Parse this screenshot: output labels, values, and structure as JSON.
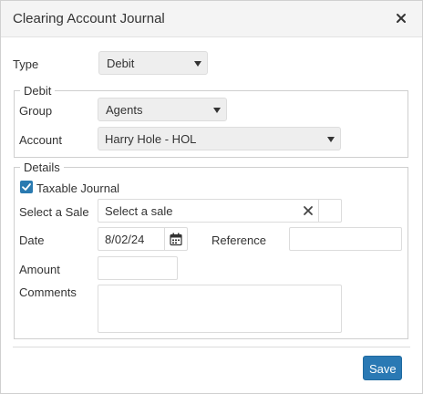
{
  "dialog": {
    "title": "Clearing Account Journal"
  },
  "type": {
    "label": "Type",
    "value": "Debit"
  },
  "debit": {
    "legend": "Debit",
    "group_label": "Group",
    "group_value": "Agents",
    "account_label": "Account",
    "account_value": "Harry Hole - HOL"
  },
  "details": {
    "legend": "Details",
    "taxable_label": "Taxable Journal",
    "taxable_checked": true,
    "sale_label": "Select a Sale",
    "sale_placeholder": "Select a sale",
    "date_label": "Date",
    "date_value": "8/02/24",
    "reference_label": "Reference",
    "reference_value": "",
    "amount_label": "Amount",
    "amount_value": "",
    "comments_label": "Comments",
    "comments_value": ""
  },
  "footer": {
    "save_label": "Save"
  },
  "colors": {
    "accent": "#2a79b4",
    "header_bg": "#f4f4f4"
  },
  "icons": {
    "close": "close-icon",
    "calendar": "calendar-icon",
    "clear": "clear-icon",
    "dropdown": "chevron-down-icon",
    "check": "check-icon"
  }
}
